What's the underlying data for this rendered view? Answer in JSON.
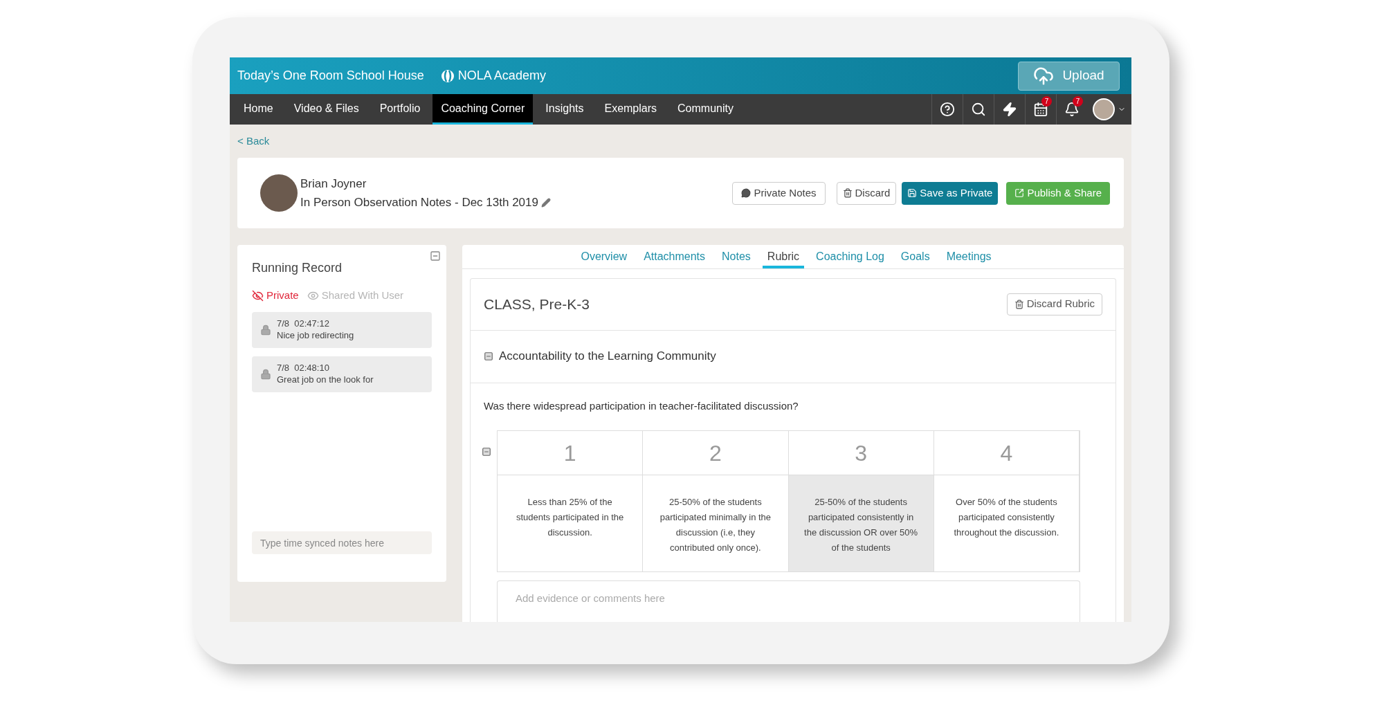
{
  "header": {
    "title": "Today’s One Room School House",
    "school": "NOLA Academy",
    "upload_button": "Upload"
  },
  "nav": {
    "items": [
      {
        "label": "Home",
        "selected": false
      },
      {
        "label": "Video & Files",
        "selected": false
      },
      {
        "label": "Portfolio",
        "selected": false
      },
      {
        "label": "Coaching Corner",
        "selected": true
      },
      {
        "label": "Insights",
        "selected": false
      },
      {
        "label": "Exemplars",
        "selected": false
      },
      {
        "label": "Community",
        "selected": false
      }
    ],
    "icons": [
      {
        "kind": "help"
      },
      {
        "kind": "search"
      },
      {
        "kind": "bolt"
      },
      {
        "kind": "calendar",
        "badge": "7"
      },
      {
        "kind": "bell",
        "badge": "7"
      },
      {
        "kind": "avatar"
      }
    ]
  },
  "back_link": "< Back",
  "observation": {
    "teacher": "Brian Joyner",
    "title": "In Person Observation Notes - Dec 13th 2019",
    "buttons": [
      {
        "kind": "notes",
        "label": "Private Notes"
      },
      {
        "kind": "discard",
        "label": "Discard"
      },
      {
        "kind": "save",
        "label": "Save as Private"
      },
      {
        "kind": "publish",
        "label": "Publish & Share"
      }
    ]
  },
  "running_record": {
    "title": "Running Record",
    "filters": [
      {
        "label": "Private",
        "selected": true
      },
      {
        "label": "Shared With User",
        "selected": false
      }
    ],
    "notes": [
      {
        "time": "7/8  02:47:12",
        "text": "Nice job redirecting"
      },
      {
        "time": "7/8  02:48:10",
        "text": "Great job on the look for"
      }
    ],
    "placeholder": "Type time synced notes here"
  },
  "tabs": [
    {
      "label": "Overview",
      "selected": false
    },
    {
      "label": "Attachments",
      "selected": false
    },
    {
      "label": "Notes",
      "selected": false
    },
    {
      "label": "Rubric",
      "selected": true
    },
    {
      "label": "Coaching Log",
      "selected": false
    },
    {
      "label": "Goals",
      "selected": false
    },
    {
      "label": "Meetings",
      "selected": false
    }
  ],
  "rubric": {
    "title": "CLASS, Pre-K-3",
    "discard_button": "Discard Rubric",
    "section": "Accountability to the Learning Community",
    "question": "Was there widespread participation in teacher-facilitated discussion?",
    "levels": [
      {
        "number": "1",
        "description": "Less than 25% of the students participated in the discussion.",
        "selected": false
      },
      {
        "number": "2",
        "description": "25-50% of the students participated minimally in the discussion (i.e, they contributed only once).",
        "selected": false
      },
      {
        "number": "3",
        "description": "25-50% of the students participated consistently in the discussion OR over 50% of the students",
        "selected": true
      },
      {
        "number": "4",
        "description": "Over 50% of the students participated consistently throughout the discussion.",
        "selected": false
      }
    ],
    "evidence_placeholder": "Add evidence or comments here"
  }
}
